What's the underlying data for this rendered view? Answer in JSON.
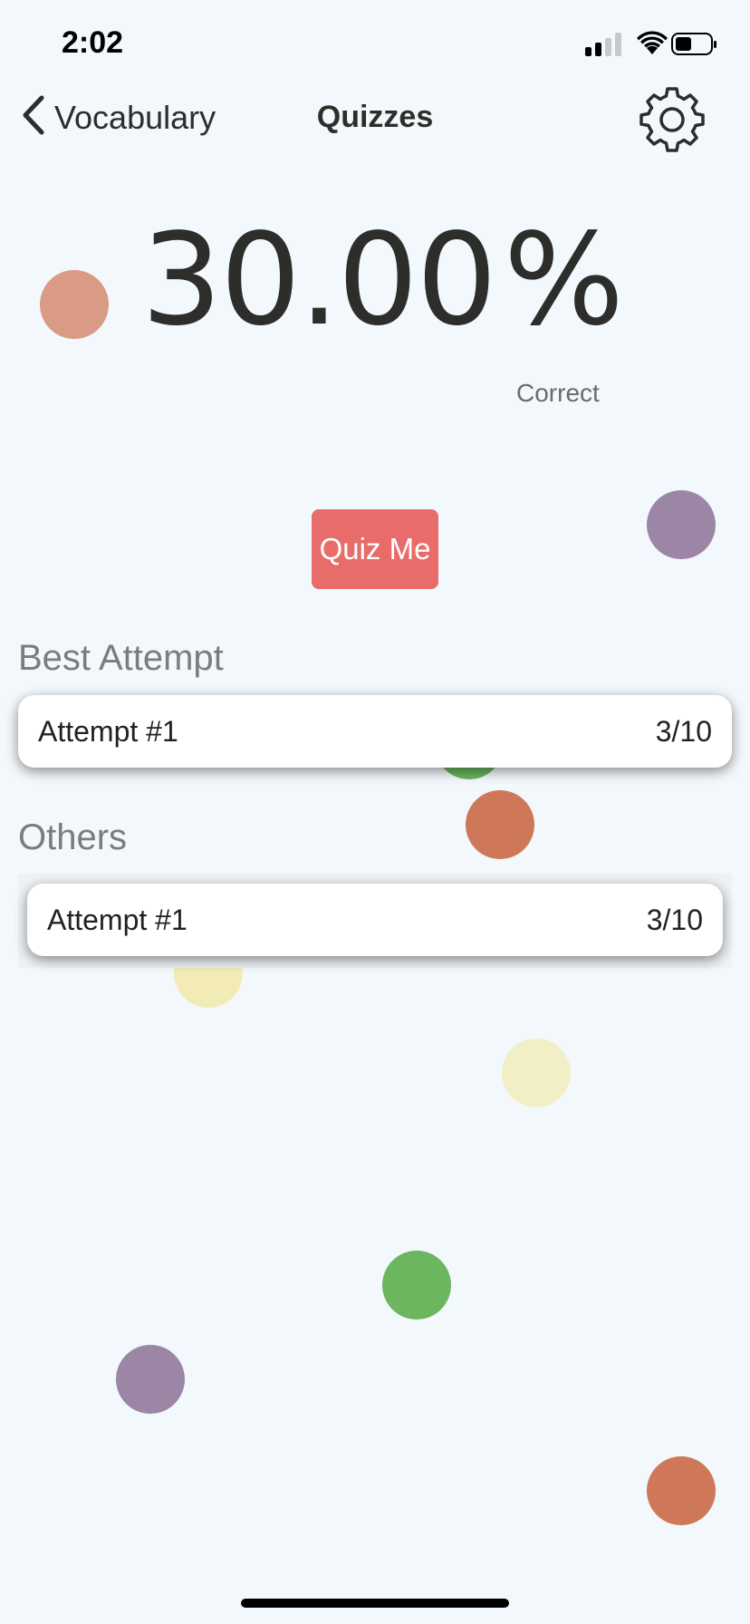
{
  "status_bar": {
    "time": "2:02"
  },
  "nav": {
    "back_label": "Vocabulary",
    "title": "Quizzes",
    "back_icon": "chevron-left-icon",
    "settings_icon": "gear-icon"
  },
  "score": {
    "value": "30.00",
    "percent_sign": "%",
    "caption": "Correct"
  },
  "quiz_button": {
    "label": "Quiz Me",
    "color": "#e86c6a"
  },
  "best_attempt": {
    "header": "Best Attempt",
    "items": [
      {
        "label": "Attempt #1",
        "score": "3/10"
      }
    ]
  },
  "others": {
    "header": "Others",
    "items": [
      {
        "label": "Attempt #1",
        "score": "3/10"
      }
    ]
  },
  "colors": {
    "background": "#f3f8fc",
    "salmon": "#d99a86",
    "purple": "#9b86a6",
    "green": "#6bb65f",
    "terracotta": "#cf7859",
    "pale_yellow": "#f3ebb6",
    "cream": "#f2efc6"
  }
}
